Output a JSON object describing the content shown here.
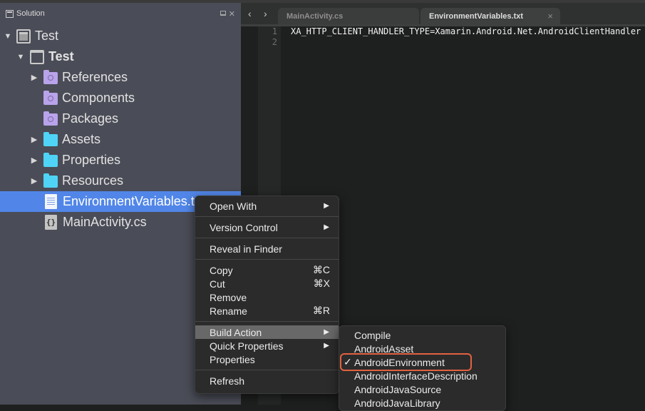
{
  "solution_pad": {
    "title": "Solution",
    "icon": "solution-pad-icon",
    "actions": [
      "dock-icon",
      "close-icon"
    ],
    "tree": [
      {
        "label": "Test",
        "icon": "solution-icon",
        "expanded": true,
        "bold": false,
        "depth": 0
      },
      {
        "label": "Test",
        "icon": "project-icon",
        "expanded": true,
        "bold": true,
        "depth": 1
      },
      {
        "label": "References",
        "icon": "references-folder-icon",
        "has_children": true,
        "depth": 2
      },
      {
        "label": "Components",
        "icon": "components-folder-icon",
        "has_children": false,
        "depth": 2
      },
      {
        "label": "Packages",
        "icon": "packages-folder-icon",
        "has_children": false,
        "depth": 2
      },
      {
        "label": "Assets",
        "icon": "folder-icon",
        "has_children": true,
        "depth": 2
      },
      {
        "label": "Properties",
        "icon": "folder-icon",
        "has_children": true,
        "depth": 2
      },
      {
        "label": "Resources",
        "icon": "folder-icon",
        "has_children": true,
        "depth": 2
      },
      {
        "label": "EnvironmentVariables.txt",
        "icon": "text-file-icon",
        "selected": true,
        "depth": 2
      },
      {
        "label": "MainActivity.cs",
        "icon": "csharp-file-icon",
        "depth": 2
      }
    ]
  },
  "editor": {
    "nav": {
      "back": "‹",
      "forward": "›"
    },
    "tabs": [
      {
        "label": "MainActivity.cs",
        "active": false
      },
      {
        "label": "EnvironmentVariables.txt",
        "active": true,
        "close": "×"
      }
    ],
    "lines": [
      {
        "number": "1",
        "text": "XA_HTTP_CLIENT_HANDLER_TYPE=Xamarin.Android.Net.AndroidClientHandler"
      },
      {
        "number": "2",
        "text": ""
      }
    ]
  },
  "context_menu": {
    "items": {
      "open_with": {
        "label": "Open With",
        "submenu": "▶"
      },
      "version_control": {
        "label": "Version Control",
        "submenu": "▶"
      },
      "reveal_in_finder": {
        "label": "Reveal in Finder"
      },
      "copy": {
        "label": "Copy",
        "shortcut": "⌘C"
      },
      "cut": {
        "label": "Cut",
        "shortcut": "⌘X"
      },
      "remove": {
        "label": "Remove"
      },
      "rename": {
        "label": "Rename",
        "shortcut": "⌘R"
      },
      "build_action": {
        "label": "Build Action",
        "submenu": "▶",
        "highlighted": true
      },
      "quick_properties": {
        "label": "Quick Properties",
        "submenu": "▶"
      },
      "properties": {
        "label": "Properties"
      },
      "refresh": {
        "label": "Refresh"
      }
    }
  },
  "build_action_submenu": {
    "checkmark": "✓",
    "selected": "AndroidEnvironment",
    "items": [
      "Compile",
      "AndroidAsset",
      "AndroidEnvironment",
      "AndroidInterfaceDescription",
      "AndroidJavaSource",
      "AndroidJavaLibrary"
    ]
  },
  "colors": {
    "selection": "#5186e8",
    "sidebar_bg": "#4a4c57",
    "editor_bg": "#1e1f1f",
    "focus_ring": "#e2623f"
  }
}
